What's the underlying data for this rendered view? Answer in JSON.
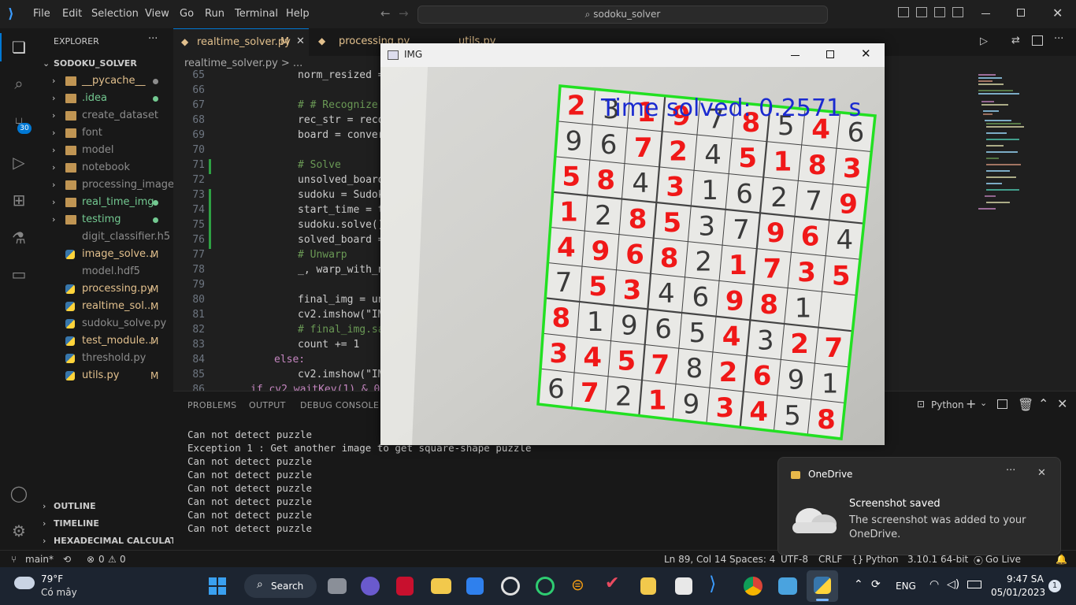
{
  "titlebar": {
    "menu": [
      "File",
      "Edit",
      "Selection",
      "View",
      "Go",
      "Run",
      "Terminal",
      "Help"
    ],
    "search": "sodoku_solver"
  },
  "explorer": {
    "header": "EXPLORER",
    "root": "SODOKU_SOLVER",
    "items": [
      {
        "label": "__pycache__",
        "folder": true,
        "color": "#e2c08d",
        "marker": "dot",
        "markerColor": "#8c8c8c"
      },
      {
        "label": ".idea",
        "folder": true,
        "color": "#73c991",
        "marker": "dot",
        "markerColor": "#73c991"
      },
      {
        "label": "create_dataset",
        "folder": true,
        "color": "#8c8c8c",
        "marker": ""
      },
      {
        "label": "font",
        "folder": true,
        "color": "#8c8c8c",
        "marker": ""
      },
      {
        "label": "model",
        "folder": true,
        "color": "#8c8c8c",
        "marker": ""
      },
      {
        "label": "notebook",
        "folder": true,
        "color": "#8c8c8c",
        "marker": ""
      },
      {
        "label": "processing_image",
        "folder": true,
        "color": "#8c8c8c",
        "marker": ""
      },
      {
        "label": "real_time_img",
        "folder": true,
        "color": "#73c991",
        "marker": "dot",
        "markerColor": "#73c991"
      },
      {
        "label": "testimg",
        "folder": true,
        "color": "#73c991",
        "marker": "dot",
        "markerColor": "#73c991"
      },
      {
        "label": "digit_classifier.h5",
        "folder": false,
        "color": "#8c8c8c",
        "marker": ""
      },
      {
        "label": "image_solve...",
        "folder": false,
        "color": "#e2c08d",
        "marker": "M",
        "py": true
      },
      {
        "label": "model.hdf5",
        "folder": false,
        "color": "#8c8c8c",
        "marker": ""
      },
      {
        "label": "processing.py",
        "folder": false,
        "color": "#e2c08d",
        "marker": "M",
        "py": true
      },
      {
        "label": "realtime_sol...",
        "folder": false,
        "color": "#e2c08d",
        "marker": "M",
        "py": true
      },
      {
        "label": "sudoku_solve.py",
        "folder": false,
        "color": "#8c8c8c",
        "marker": "",
        "py": true
      },
      {
        "label": "test_module...",
        "folder": false,
        "color": "#e2c08d",
        "marker": "M",
        "py": true
      },
      {
        "label": "threshold.py",
        "folder": false,
        "color": "#8c8c8c",
        "marker": "",
        "py": true
      },
      {
        "label": "utils.py",
        "folder": false,
        "color": "#e2c08d",
        "marker": "M",
        "py": true
      }
    ],
    "sections": [
      "OUTLINE",
      "TIMELINE",
      "HEXADECIMAL CALCULATOR"
    ]
  },
  "tabs": [
    {
      "label": "realtime_solver.py",
      "mark": "M",
      "active": true
    },
    {
      "label": "processing.py",
      "mark": "M",
      "active": false
    },
    {
      "label": "utils.py",
      "mark": "M",
      "active": false
    }
  ],
  "breadcrumb": "realtime_solver.py > ...",
  "code": [
    {
      "n": "65",
      "indent": 5,
      "text": "norm_resized =",
      "color": "#cccccc"
    },
    {
      "n": "66",
      "indent": 0,
      "text": "",
      "color": "#cccccc"
    },
    {
      "n": "67",
      "indent": 5,
      "text": "# # Recognize",
      "color": "#6a9955"
    },
    {
      "n": "68",
      "indent": 5,
      "text": "rec_str = reco",
      "color": "#cccccc"
    },
    {
      "n": "69",
      "indent": 5,
      "text": "board = conver",
      "color": "#cccccc"
    },
    {
      "n": "70",
      "indent": 0,
      "text": "",
      "color": "#cccccc"
    },
    {
      "n": "71",
      "indent": 5,
      "text": "# Solve",
      "color": "#6a9955"
    },
    {
      "n": "72",
      "indent": 5,
      "text": "unsolved_board",
      "color": "#cccccc"
    },
    {
      "n": "73",
      "indent": 5,
      "text": "sudoku = Sudok",
      "color": "#cccccc"
    },
    {
      "n": "74",
      "indent": 5,
      "text": "start_time = t",
      "color": "#cccccc"
    },
    {
      "n": "75",
      "indent": 5,
      "text": "sudoku.solve()",
      "color": "#cccccc"
    },
    {
      "n": "76",
      "indent": 5,
      "text": "solved_board =",
      "color": "#cccccc"
    },
    {
      "n": "77",
      "indent": 5,
      "text": "# Unwarp",
      "color": "#6a9955"
    },
    {
      "n": "78",
      "indent": 5,
      "text": "_, warp_with_n",
      "color": "#cccccc"
    },
    {
      "n": "79",
      "indent": 0,
      "text": "",
      "color": "#cccccc"
    },
    {
      "n": "80",
      "indent": 5,
      "text": "final_img = un",
      "color": "#cccccc"
    },
    {
      "n": "81",
      "indent": 5,
      "text": "cv2.imshow(\"IM",
      "color": "#cccccc"
    },
    {
      "n": "82",
      "indent": 5,
      "text": "# final_img.sa",
      "color": "#6a9955"
    },
    {
      "n": "83",
      "indent": 5,
      "text": "count += 1",
      "color": "#cccccc"
    },
    {
      "n": "84",
      "indent": 4,
      "text": "else:",
      "color": "#c586c0"
    },
    {
      "n": "85",
      "indent": 5,
      "text": "cv2.imshow(\"IM",
      "color": "#cccccc"
    },
    {
      "n": "86",
      "indent": 3,
      "text": "if cv2.waitKey(1) & 0x",
      "color": "#c586c0"
    }
  ],
  "panel": {
    "tabs": [
      "PROBLEMS",
      "OUTPUT",
      "DEBUG CONSOLE"
    ],
    "terminal_label": "Python",
    "lines": [
      "Can not detect puzzle",
      "Exception 1 : Get another image to get square-shape puzzle",
      "Can not detect puzzle",
      "Can not detect puzzle",
      "Can not detect puzzle",
      "Can not detect puzzle",
      "Can not detect puzzle",
      "Can not detect puzzle"
    ]
  },
  "status": {
    "branch": "main*",
    "errors": "0",
    "warnings": "0",
    "position": "Ln 89, Col 14",
    "spaces": "Spaces: 4",
    "encoding": "UTF-8",
    "eol": "CRLF",
    "language": "Python",
    "version": "3.10.1 64-bit",
    "golive": "Go Live"
  },
  "imgwindow": {
    "title": "IMG",
    "overlay": "Time solved: 0.2571 s",
    "grid": [
      [
        "2",
        "3",
        "1",
        "9",
        "7",
        "8",
        "5",
        "4",
        "6"
      ],
      [
        "9",
        "6",
        "7",
        "2",
        "4",
        "5",
        "1",
        "8",
        "3"
      ],
      [
        "5",
        "8",
        "4",
        "3",
        "1",
        "6",
        "2",
        "7",
        "9"
      ],
      [
        "1",
        "2",
        "8",
        "5",
        "3",
        "7",
        "9",
        "6",
        "4"
      ],
      [
        "4",
        "9",
        "6",
        "8",
        "2",
        "1",
        "7",
        "3",
        "5"
      ],
      [
        "7",
        "5",
        "3",
        "4",
        "6",
        "9",
        "8",
        "1",
        ""
      ],
      [
        "8",
        "1",
        "9",
        "6",
        "5",
        "4",
        "3",
        "2",
        "7"
      ],
      [
        "3",
        "4",
        "5",
        "7",
        "8",
        "2",
        "6",
        "9",
        "1"
      ],
      [
        "6",
        "7",
        "2",
        "1",
        "9",
        "3",
        "4",
        "5",
        "8"
      ]
    ],
    "red": [
      [
        1,
        0,
        1,
        1,
        0,
        1,
        0,
        1,
        0
      ],
      [
        0,
        0,
        1,
        1,
        0,
        1,
        1,
        1,
        1
      ],
      [
        1,
        1,
        0,
        1,
        0,
        0,
        0,
        0,
        1
      ],
      [
        1,
        0,
        1,
        1,
        0,
        0,
        1,
        1,
        0
      ],
      [
        1,
        1,
        1,
        1,
        0,
        1,
        1,
        1,
        1
      ],
      [
        0,
        1,
        1,
        0,
        0,
        1,
        1,
        0,
        0
      ],
      [
        1,
        0,
        0,
        0,
        0,
        1,
        0,
        1,
        1
      ],
      [
        1,
        1,
        1,
        1,
        0,
        1,
        1,
        0,
        0
      ],
      [
        0,
        1,
        0,
        1,
        0,
        1,
        1,
        0,
        1
      ]
    ]
  },
  "toast": {
    "app": "OneDrive",
    "title": "Screenshot saved",
    "body": "The screenshot was added to your OneDrive."
  },
  "taskbar": {
    "weather_temp": "79°F",
    "weather_desc": "Có mây",
    "search": "Search",
    "lang": "ENG",
    "time": "9:47 SA",
    "date": "05/01/2023",
    "badge": "1",
    "source_control_badge": "30"
  }
}
